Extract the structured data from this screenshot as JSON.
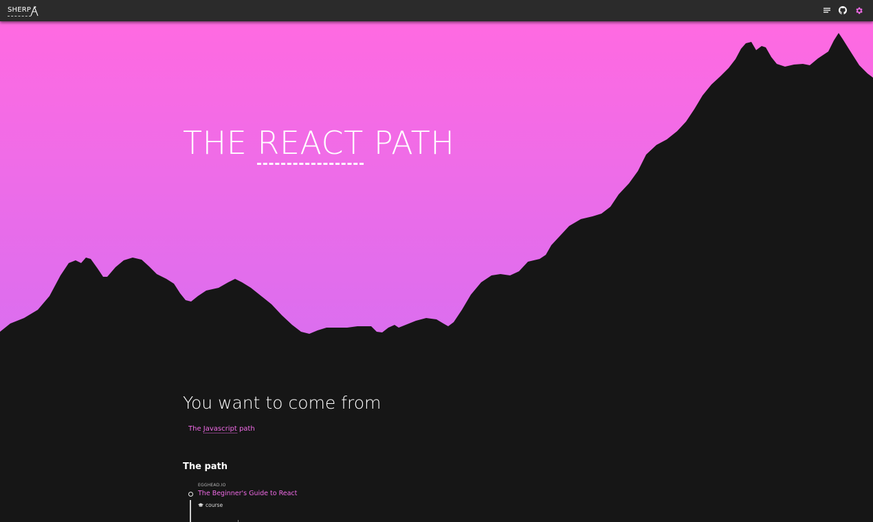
{
  "header": {
    "logo_text": "SHERP",
    "icons": [
      "list-icon",
      "github-icon",
      "gear-icon"
    ],
    "accent_color": "#f06ae6"
  },
  "hero": {
    "title_before": "THE ",
    "title_accent": "REACT",
    "title_after": " PATH",
    "gradient_top": "#ff6ae1",
    "gradient_bottom": "#d86ef0",
    "mountain_color": "#161616"
  },
  "from_section": {
    "title": "You want to come from",
    "link_prefix": "The ",
    "link_dotted": "Javascript",
    "link_suffix": " path"
  },
  "path_section": {
    "title": "The path",
    "steps": [
      {
        "provider": "EGGHEAD.IO",
        "title": "The Beginner's Guide to React",
        "type": "course",
        "type_icon": "graduation-cap-icon"
      }
    ]
  }
}
